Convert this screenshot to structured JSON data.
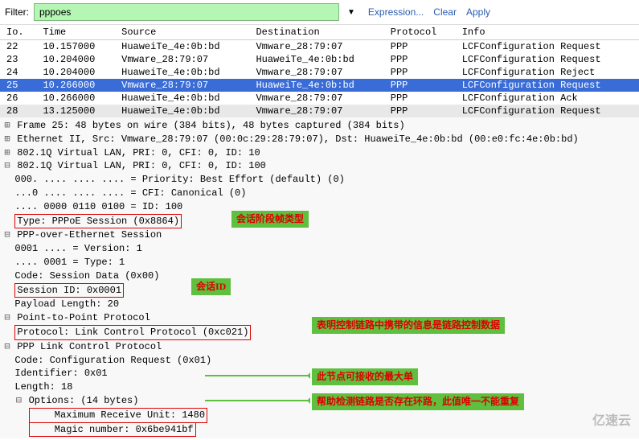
{
  "filter": {
    "label": "Filter:",
    "value": "pppoes",
    "expression": "Expression...",
    "clear": "Clear",
    "apply": "Apply"
  },
  "cols": {
    "no": "Io.",
    "time": "Time",
    "source": "Source",
    "dest": "Destination",
    "proto": "Protocol",
    "info": "Info"
  },
  "packets": [
    {
      "no": "22",
      "time": "10.157000",
      "src": "HuaweiTe_4e:0b:bd",
      "dst": "Vmware_28:79:07",
      "proto": "PPP",
      "info": "LCFConfiguration Request",
      "sel": false,
      "alt": false
    },
    {
      "no": "23",
      "time": "10.204000",
      "src": "Vmware_28:79:07",
      "dst": "HuaweiTe_4e:0b:bd",
      "proto": "PPP",
      "info": "LCFConfiguration Request",
      "sel": false,
      "alt": false
    },
    {
      "no": "24",
      "time": "10.204000",
      "src": "HuaweiTe_4e:0b:bd",
      "dst": "Vmware_28:79:07",
      "proto": "PPP",
      "info": "LCFConfiguration Reject",
      "sel": false,
      "alt": false
    },
    {
      "no": "25",
      "time": "10.266000",
      "src": "Vmware_28:79:07",
      "dst": "HuaweiTe_4e:0b:bd",
      "proto": "PPP",
      "info": "LCFConfiguration Request",
      "sel": true,
      "alt": false
    },
    {
      "no": "26",
      "time": "10.266000",
      "src": "HuaweiTe_4e:0b:bd",
      "dst": "Vmware_28:79:07",
      "proto": "PPP",
      "info": "LCFConfiguration Ack",
      "sel": false,
      "alt": false
    },
    {
      "no": "28",
      "time": "13.125000",
      "src": "HuaweiTe_4e:0b:bd",
      "dst": "Vmware_28:79:07",
      "proto": "PPP",
      "info": "LCFConfiguration Request",
      "sel": false,
      "alt": true
    }
  ],
  "tree": {
    "frame": "Frame 25: 48 bytes on wire (384 bits), 48 bytes captured (384 bits)",
    "eth": "Ethernet II, Src: Vmware_28:79:07 (00:0c:29:28:79:07), Dst: HuaweiTe_4e:0b:bd (00:e0:fc:4e:0b:bd)",
    "vlan1": "802.1Q Virtual LAN, PRI: 0, CFI: 0, ID: 10",
    "vlan2": "802.1Q Virtual LAN, PRI: 0, CFI: 0, ID: 100",
    "vlan2_pri": "  000. .... .... .... = Priority: Best Effort (default) (0)",
    "vlan2_cfi": "  ...0 .... .... .... = CFI: Canonical (0)",
    "vlan2_id": "  .... 0000 0110 0100 = ID: 100",
    "vlan2_type": "Type: PPPoE Session (0x8864)",
    "pppoe": "PPP-over-Ethernet Session",
    "pppoe_ver": "  0001 .... = Version: 1",
    "pppoe_typ": "  .... 0001 = Type: 1",
    "pppoe_code": "  Code: Session Data (0x00)",
    "pppoe_sid": "Session ID: 0x0001",
    "pppoe_len": "  Payload Length: 20",
    "p2p": "Point-to-Point Protocol",
    "p2p_proto": "Protocol: Link Control Protocol (0xc021)",
    "lcp": "PPP Link Control Protocol",
    "lcp_code": "  Code: Configuration Request (0x01)",
    "lcp_id": "  Identifier: 0x01",
    "lcp_len": "  Length: 18",
    "lcp_opt": "Options: (14 bytes)",
    "lcp_mru": "    Maximum Receive Unit: 1480",
    "lcp_magic": "    Magic number: 0x6be941bf"
  },
  "annot": {
    "a1": "会话阶段帧类型",
    "a2": "会话ID",
    "a3": "表明控制链路中携带的信息是链路控制数据",
    "a4": "此节点可接收的最大单",
    "a5": "帮助检测链路是否存在环路，此值唯一不能重复"
  },
  "logo": "亿速云"
}
